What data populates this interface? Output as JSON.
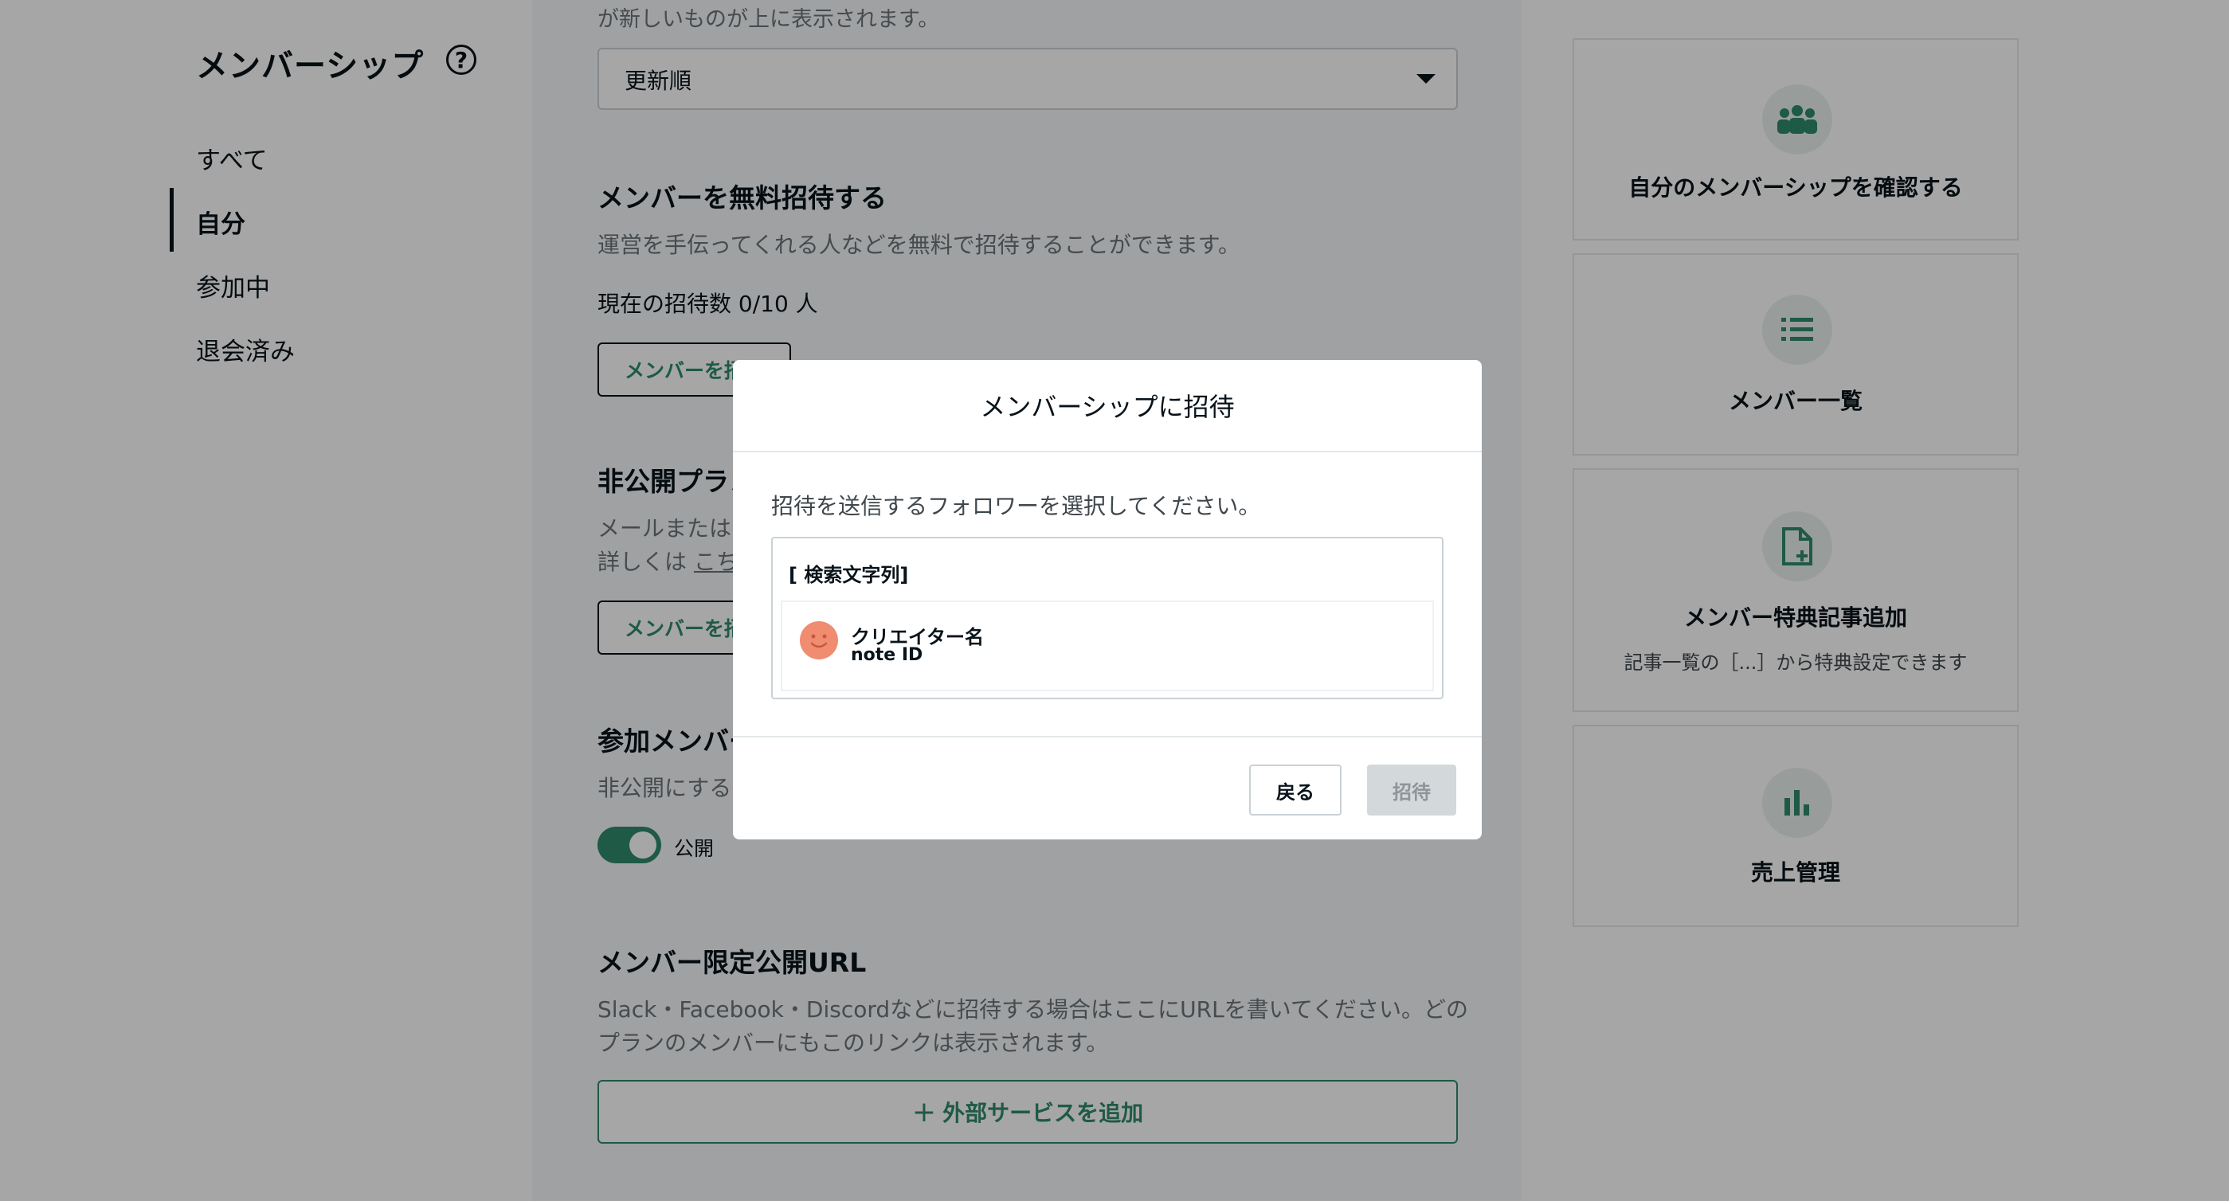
{
  "sidebar": {
    "title": "メンバーシップ",
    "help_icon": "?",
    "items": [
      {
        "label": "すべて",
        "active": false
      },
      {
        "label": "自分",
        "active": true
      },
      {
        "label": "参加中",
        "active": false
      },
      {
        "label": "退会済み",
        "active": false
      }
    ]
  },
  "main": {
    "sort_hint": "が新しいものが上に表示されます。",
    "sort_select": {
      "value": "更新順"
    },
    "free_invite": {
      "title": "メンバーを無料招待する",
      "description": "運営を手伝ってくれる人などを無料で招待することができます。",
      "count_text": "現在の招待数 0/10 人",
      "button_label": "メンバーを招待"
    },
    "private_plan": {
      "title": "非公開プラン",
      "description_line1": "メールまたは",
      "description_line2_prefix": "詳しくは",
      "description_link": "こちら",
      "button_label": "メンバーを招待"
    },
    "member_visibility": {
      "title": "参加メンバー",
      "description": "非公開にする",
      "toggle_label": "公開",
      "toggle_on": true
    },
    "member_url": {
      "title": "メンバー限定公開URL",
      "description_line1": "Slack・Facebook・Discordなどに招待する場合はここにURLを書いてください。どの",
      "description_line2": "プランのメンバーにもこのリンクは表示されます。",
      "add_button_label": "外部サービスを追加"
    }
  },
  "right_cards": [
    {
      "icon": "group-icon",
      "label": "自分のメンバーシップを確認する"
    },
    {
      "icon": "list-icon",
      "label": "メンバー一覧"
    },
    {
      "icon": "file-add-icon",
      "label": "メンバー特典記事追加",
      "sub": "記事一覧の［...］から特典設定できます"
    },
    {
      "icon": "bar-chart-icon",
      "label": "売上管理"
    }
  ],
  "modal": {
    "title": "メンバーシップに招待",
    "description": "招待を送信するフォロワーを選択してください。",
    "search_text": "[ 検索文字列]",
    "result": {
      "name": "クリエイター名",
      "id": "note ID"
    },
    "back_label": "戻る",
    "invite_label": "招待"
  },
  "colors": {
    "accent": "#2e8a6a",
    "text": "#08131a",
    "muted": "#6b7378",
    "avatar": "#f08c70"
  }
}
